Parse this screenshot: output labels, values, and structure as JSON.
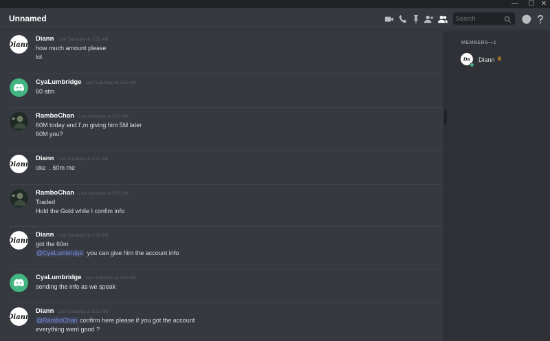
{
  "window": {
    "controls": {
      "minimize": "—",
      "maximize": "☐",
      "close": "✕"
    }
  },
  "header": {
    "title": "Unnamed",
    "icons": [
      "video-call-icon",
      "voice-call-icon",
      "pin-icon",
      "add-member-icon",
      "members-icon",
      "mention-icon",
      "help-icon"
    ],
    "search_placeholder": "Search"
  },
  "messages": [
    {
      "author": "Diann",
      "timestamp": "Last Saturday at 3:51 AM",
      "avatar": "diann-logo",
      "lines": [
        [
          {
            "text": "how much amount please"
          }
        ],
        [
          {
            "text": "lol"
          }
        ]
      ]
    },
    {
      "author": "CyaLumbridge",
      "timestamp": "Last Saturday at 3:51 AM",
      "avatar": "discord-default-green",
      "lines": [
        [
          {
            "text": "60 atm"
          }
        ]
      ]
    },
    {
      "author": "RamboChan",
      "timestamp": "Last Saturday at 3:51 AM",
      "avatar": "rambochan-photo",
      "lines": [
        [
          {
            "text": "60M today and I',m giving him 5M later"
          }
        ],
        [
          {
            "text": "60M you?"
          }
        ]
      ]
    },
    {
      "author": "Diann",
      "timestamp": "Last Saturday at 3:51 AM",
      "avatar": "diann-logo",
      "lines": [
        [
          {
            "text": "oke  . 60m me"
          }
        ]
      ]
    },
    {
      "author": "RamboChan",
      "timestamp": "Last Saturday at 3:52 AM",
      "avatar": "rambochan-photo",
      "lines": [
        [
          {
            "text": "Traded"
          }
        ],
        [
          {
            "text": "Hold the Gold while I confim info"
          }
        ]
      ]
    },
    {
      "author": "Diann",
      "timestamp": "Last Saturday at 3:52 AM",
      "avatar": "diann-logo",
      "lines": [
        [
          {
            "text": "got the 60m"
          }
        ],
        [
          {
            "text": "@CyaLumbridge",
            "mention": true
          },
          {
            "text": "  you can give him the account info"
          }
        ]
      ]
    },
    {
      "author": "CyaLumbridge",
      "timestamp": "Last Saturday at 3:52 AM",
      "avatar": "discord-default-green",
      "lines": [
        [
          {
            "text": "sending the info as we speak"
          }
        ]
      ]
    },
    {
      "author": "Diann",
      "timestamp": "Last Saturday at 3:53 AM",
      "avatar": "diann-logo",
      "lines": [
        [
          {
            "text": "@RamboChan",
            "mention": true
          },
          {
            "text": " confirm here please if you got the account"
          }
        ],
        [
          {
            "text": "everything went good ?"
          }
        ]
      ]
    }
  ],
  "members": {
    "header": "MEMBERS—1",
    "list": [
      {
        "name": "Diann",
        "status": "online",
        "badge": "crown-icon"
      }
    ]
  },
  "colors": {
    "mention": "#7289da",
    "online": "#43b581",
    "crown": "#faa61a",
    "discord_green": "#43b581"
  }
}
